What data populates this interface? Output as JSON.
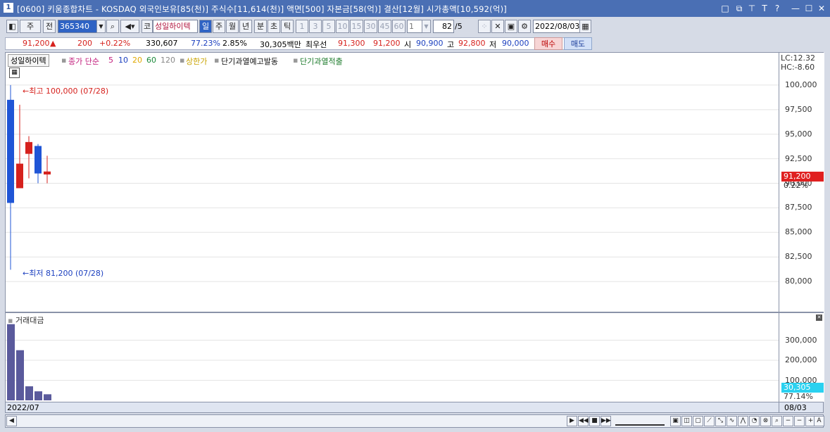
{
  "window": {
    "number": "1",
    "title": "[0600] 키움종합차트 - KOSDAQ 외국인보유[85(천)] 주식수[11,614(천)] 액면[500] 자본금[58(억)] 결산[12월] 시가총액[10,592(억)]",
    "buttons": [
      "□",
      "⧉",
      "⊤",
      "T",
      "?",
      "—",
      "☐",
      "✕"
    ]
  },
  "toolbar": {
    "type_btn": "주",
    "prev_btn": "전",
    "code": "365340",
    "stock_name": "성일하이텍",
    "period_tabs": [
      "일",
      "주",
      "월",
      "년",
      "분",
      "초",
      "틱"
    ],
    "period_selected": "일",
    "minute_tabs": [
      "1",
      "3",
      "5",
      "10",
      "15",
      "30",
      "45",
      "60"
    ],
    "count": "1",
    "zoom": "82",
    "zoom_suffix": "/5",
    "date": "2022/08/03",
    "corp_label": "코"
  },
  "pricebar": {
    "price": "91,200",
    "arrow": "▲",
    "change": "200",
    "change_pct": "+0.22%",
    "volume": "330,607",
    "vol_ratio": "77.23%",
    "turnover": "2.85%",
    "amount": "30,305백만",
    "best_label": "최우선",
    "ask": "91,300",
    "bid": "91,200",
    "open_label": "시",
    "open": "90,900",
    "high_label": "고",
    "high": "92,800",
    "low_label": "저",
    "low": "90,000",
    "buy_btn": "매수",
    "sell_btn": "매도"
  },
  "legend": {
    "stock": "성일하이텍",
    "close_label": "종가 단순",
    "ma5": "5",
    "ma10": "10",
    "ma20": "20",
    "ma60": "60",
    "ma120": "120",
    "upper_limit": "상한가",
    "warn1": "단기과열예고발동",
    "warn2": "단기과열적출"
  },
  "right_info": {
    "lc": "LC:12.32",
    "hc": "HC:-8.60"
  },
  "price_axis": [
    "100,000",
    "97,500",
    "95,000",
    "92,500",
    "90,000",
    "87,500",
    "85,000",
    "82,500",
    "80,000"
  ],
  "current": {
    "price": "91,200",
    "pct": "0.22%"
  },
  "annotations": {
    "high": "최고 100,000 (07/28)",
    "low": "최저 81,200 (07/28)"
  },
  "volume_panel": {
    "title": "거래대금",
    "axis": [
      "300,000",
      "200,000",
      "100,000"
    ],
    "current": "30,305",
    "pct": "77.14%"
  },
  "dates": {
    "left": "2022/07",
    "right": "08/03"
  },
  "chart_data": {
    "type": "candlestick",
    "candles": [
      {
        "date": "07/28",
        "open": 98500,
        "high": 100000,
        "low": 81200,
        "close": 88000,
        "color": "#1f55d6"
      },
      {
        "date": "07/29",
        "open": 89500,
        "high": 98000,
        "low": 89500,
        "close": 92000,
        "color": "#d6211d"
      },
      {
        "date": "08/01",
        "open": 93000,
        "high": 94800,
        "low": 90500,
        "close": 94200,
        "color": "#d6211d"
      },
      {
        "date": "08/02",
        "open": 93800,
        "high": 94000,
        "low": 90000,
        "close": 91000,
        "color": "#1f55d6"
      },
      {
        "date": "08/03",
        "open": 90900,
        "high": 92800,
        "low": 90000,
        "close": 91200,
        "color": "#d6211d"
      }
    ],
    "amounts": [
      380000,
      250000,
      70000,
      45000,
      30305
    ],
    "ylim": [
      77500,
      102000
    ],
    "vol_ylim": [
      0,
      400000
    ]
  }
}
